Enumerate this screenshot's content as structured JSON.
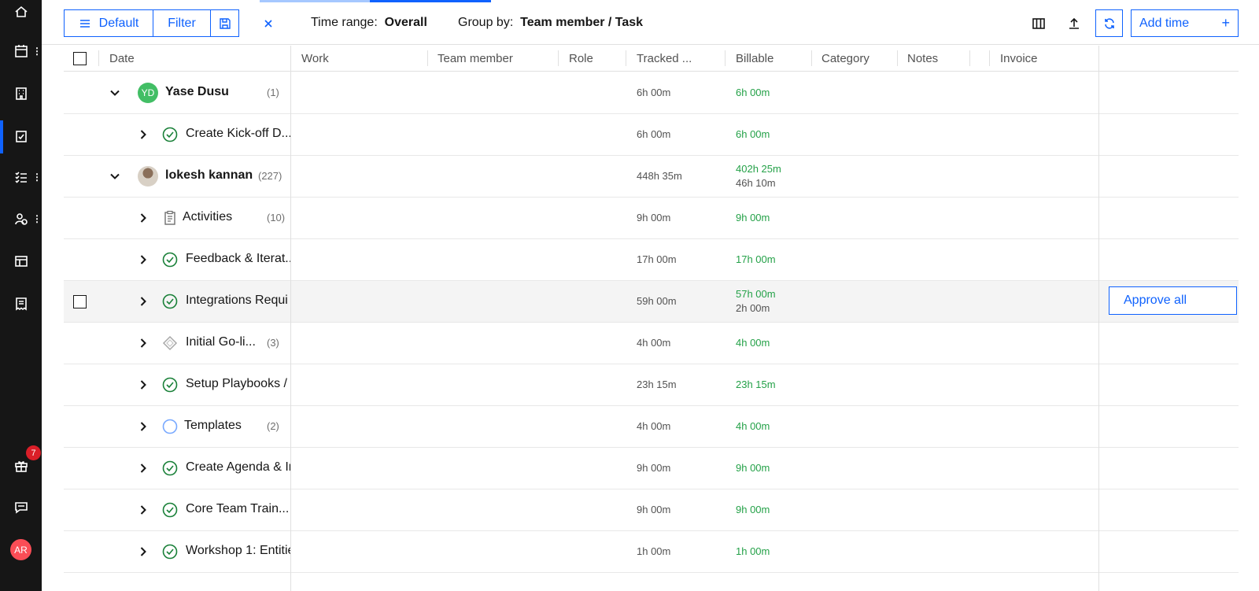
{
  "sidebar": {
    "notification_count": "7",
    "user_initials": "AR",
    "icons": [
      "home-icon",
      "calendar-icon",
      "building-icon",
      "timesheet-icon",
      "checklist-icon",
      "people-icon",
      "layout-icon",
      "receipt-icon",
      "gift-icon",
      "chat-icon"
    ]
  },
  "toolbar": {
    "view_label": "Default",
    "filter_label": "Filter",
    "time_range_label": "Time range:",
    "time_range_value": "Overall",
    "group_by_label": "Group by:",
    "group_by_value": "Team member / Task",
    "add_time_label": "Add time",
    "add_time_plus": "+"
  },
  "table": {
    "columns": [
      "Date",
      "Work",
      "Team member",
      "Role",
      "Tracked ...",
      "Billable",
      "Category",
      "Notes",
      "Invoice"
    ],
    "rows": [
      {
        "level": "member",
        "name": "Yase Dusu",
        "initials": "YD",
        "count": "(1)",
        "tracked": "6h 00m",
        "billable": "6h 00m",
        "nonbillable": ""
      },
      {
        "level": "task",
        "icon": "check-circle",
        "name": "Create Kick-off D...",
        "count": "",
        "tracked": "6h 00m",
        "billable": "6h 00m",
        "nonbillable": ""
      },
      {
        "level": "member",
        "name": "lokesh kannan",
        "count": "(227)",
        "tracked": "448h 35m",
        "billable": "402h 25m",
        "nonbillable": "46h 10m"
      },
      {
        "level": "task",
        "icon": "clipboard",
        "name": "Activities",
        "count": "(10)",
        "tracked": "9h 00m",
        "billable": "9h 00m",
        "nonbillable": ""
      },
      {
        "level": "task",
        "icon": "check-circle",
        "name": "Feedback & Iterat...",
        "count": "",
        "tracked": "17h 00m",
        "billable": "17h 00m",
        "nonbillable": ""
      },
      {
        "level": "task",
        "icon": "check-circle",
        "name": "Integrations Requi",
        "count": "",
        "tracked": "59h 00m",
        "billable": "57h 00m",
        "nonbillable": "2h 00m",
        "action": "Approve all"
      },
      {
        "level": "task",
        "icon": "diamond",
        "name": "Initial Go-li...",
        "count": "(3)",
        "tracked": "4h 00m",
        "billable": "4h 00m",
        "nonbillable": ""
      },
      {
        "level": "task",
        "icon": "check-circle",
        "name": "Setup Playbooks / I",
        "count": "",
        "tracked": "23h 15m",
        "billable": "23h 15m",
        "nonbillable": ""
      },
      {
        "level": "task",
        "icon": "open-circle",
        "name": "Templates",
        "count": "(2)",
        "tracked": "4h 00m",
        "billable": "4h 00m",
        "nonbillable": ""
      },
      {
        "level": "task",
        "icon": "check-circle",
        "name": "Create Agenda & Ir",
        "count": "",
        "tracked": "9h 00m",
        "billable": "9h 00m",
        "nonbillable": ""
      },
      {
        "level": "task",
        "icon": "check-circle",
        "name": "Core Team Train...",
        "count": "",
        "tracked": "9h 00m",
        "billable": "9h 00m",
        "nonbillable": ""
      },
      {
        "level": "task",
        "icon": "check-circle",
        "name": "Workshop 1: Entitie",
        "count": "",
        "tracked": "1h 00m",
        "billable": "1h 00m",
        "nonbillable": ""
      }
    ]
  },
  "colors": {
    "accent": "#0f62fe",
    "billable": "#24a148",
    "sidebar": "#161616",
    "badge": "#da1e28"
  }
}
